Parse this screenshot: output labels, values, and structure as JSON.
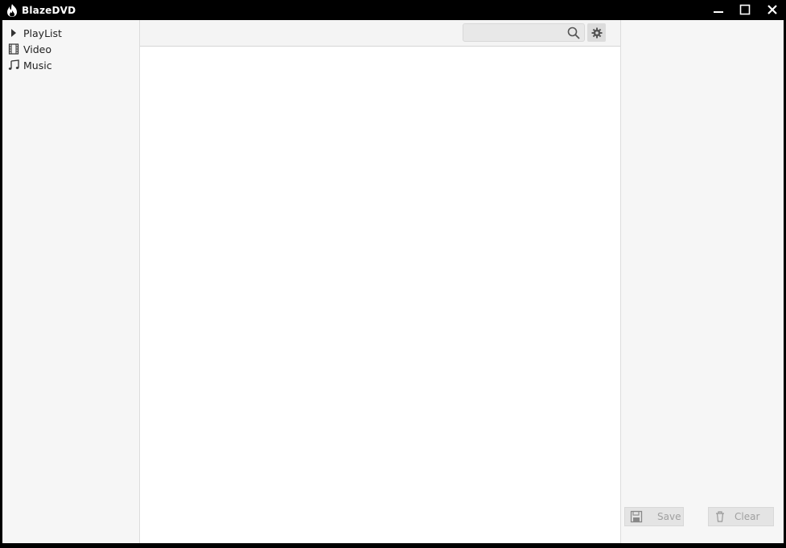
{
  "app": {
    "title": "BlazeDVD"
  },
  "window_controls": {
    "minimize": "minimize",
    "maximize": "maximize",
    "close": "close"
  },
  "sidebar": {
    "items": [
      {
        "label": "PlayList",
        "icon": "play-triangle-icon"
      },
      {
        "label": "Video",
        "icon": "film-icon"
      },
      {
        "label": "Music",
        "icon": "music-note-icon"
      }
    ]
  },
  "toolbar": {
    "search": {
      "value": "",
      "placeholder": ""
    },
    "search_icon": "search-icon",
    "settings_icon": "gear-icon"
  },
  "right_panel": {
    "save_label": "Save",
    "clear_label": "Clear"
  },
  "colors": {
    "titlebar": "#000000",
    "panel": "#f6f6f6",
    "content": "#ffffff",
    "border": "#dcdcdc",
    "button": "#e4e4e4",
    "disabled_text": "#a0a0a0"
  }
}
